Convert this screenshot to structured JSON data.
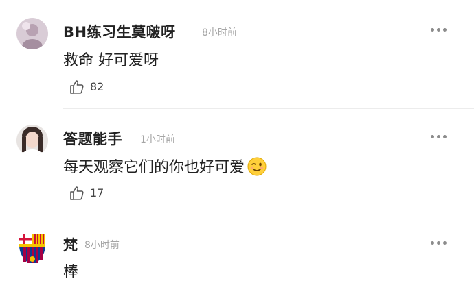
{
  "comments": [
    {
      "username": "BH练习生莫啵呀",
      "time": "8小时前",
      "text": "救命 好可爱呀",
      "likes": "82",
      "avatar_icon": "avatar-icon",
      "more_icon": "more-dots-icon"
    },
    {
      "username": "答题能手",
      "time": "1小时前",
      "text": "每天观察它们的你也好可爱",
      "emoji": "wink-emoji-icon",
      "likes": "17",
      "avatar_icon": "avatar-icon",
      "more_icon": "more-dots-icon"
    },
    {
      "username": "梵",
      "time": "8小时前",
      "text": "棒",
      "avatar_icon": "fc-barcelona-crest-icon",
      "more_icon": "more-dots-icon"
    }
  ]
}
